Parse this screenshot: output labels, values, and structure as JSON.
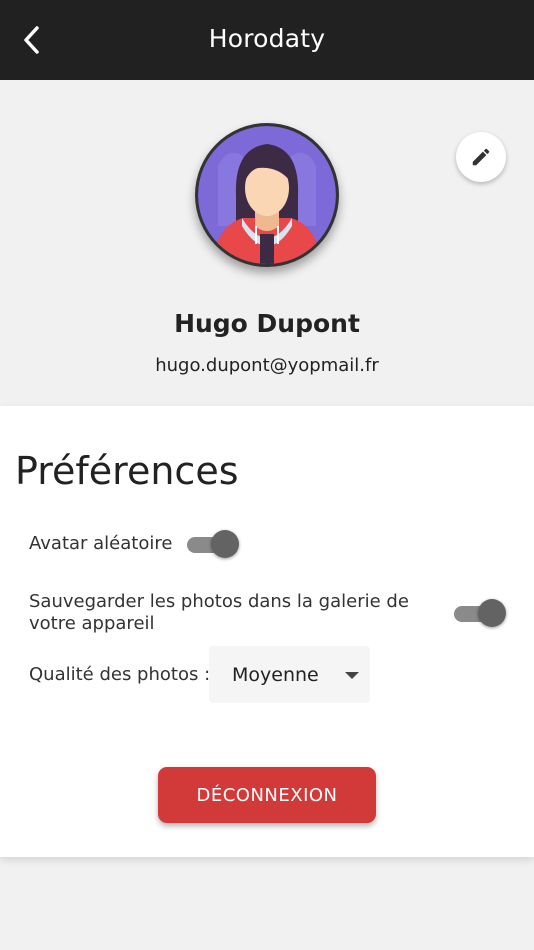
{
  "appbar": {
    "title": "Horodaty",
    "back_icon": "chevron-left-icon"
  },
  "profile": {
    "name": "Hugo Dupont",
    "email": "hugo.dupont@yopmail.fr",
    "edit_icon": "pencil-icon",
    "avatar_icon": "avatar-woman-illustration"
  },
  "preferences": {
    "title": "Préférences",
    "random_avatar": {
      "label": "Avatar aléatoire",
      "enabled": true
    },
    "save_to_gallery": {
      "label_line1": "Sauvegarder les photos dans la galerie de",
      "label_line2": "votre appareil",
      "enabled": true
    },
    "photo_quality": {
      "label": "Qualité des photos :",
      "value": "Moyenne"
    }
  },
  "logout": {
    "label": "DÉCONNEXION"
  },
  "colors": {
    "appbar": "#212121",
    "logout": "#d23a3a",
    "toggle_track": "#8a8a8a",
    "toggle_thumb": "#636363"
  }
}
